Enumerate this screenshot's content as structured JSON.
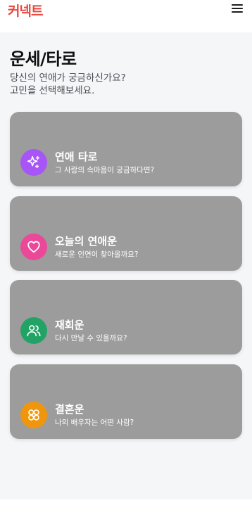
{
  "header": {
    "logo_text": "커넥트",
    "logo_color": "#e8473f",
    "menu_icon": "hamburger-menu-icon"
  },
  "page": {
    "title": "운세/타로",
    "subtitle_line1": "당신의 연애가 궁금하신가요?",
    "subtitle_line2": "고민을 선택해보세요."
  },
  "cards": [
    {
      "title": "연애 타로",
      "description": "그 사람의 속마음이 궁금하다면?",
      "icon": "sparkles-icon",
      "icon_bg": "#a855f7"
    },
    {
      "title": "오늘의 연애운",
      "description": "새로운 인연이 찾아올까요?",
      "icon": "heart-icon",
      "icon_bg": "#ec4899"
    },
    {
      "title": "재회운",
      "description": "다시 만날 수 있을까요?",
      "icon": "users-icon",
      "icon_bg": "#22a366"
    },
    {
      "title": "결혼운",
      "description": "나의 배우자는 어떤 사람?",
      "icon": "flower-icon",
      "icon_bg": "#f0960c"
    }
  ]
}
